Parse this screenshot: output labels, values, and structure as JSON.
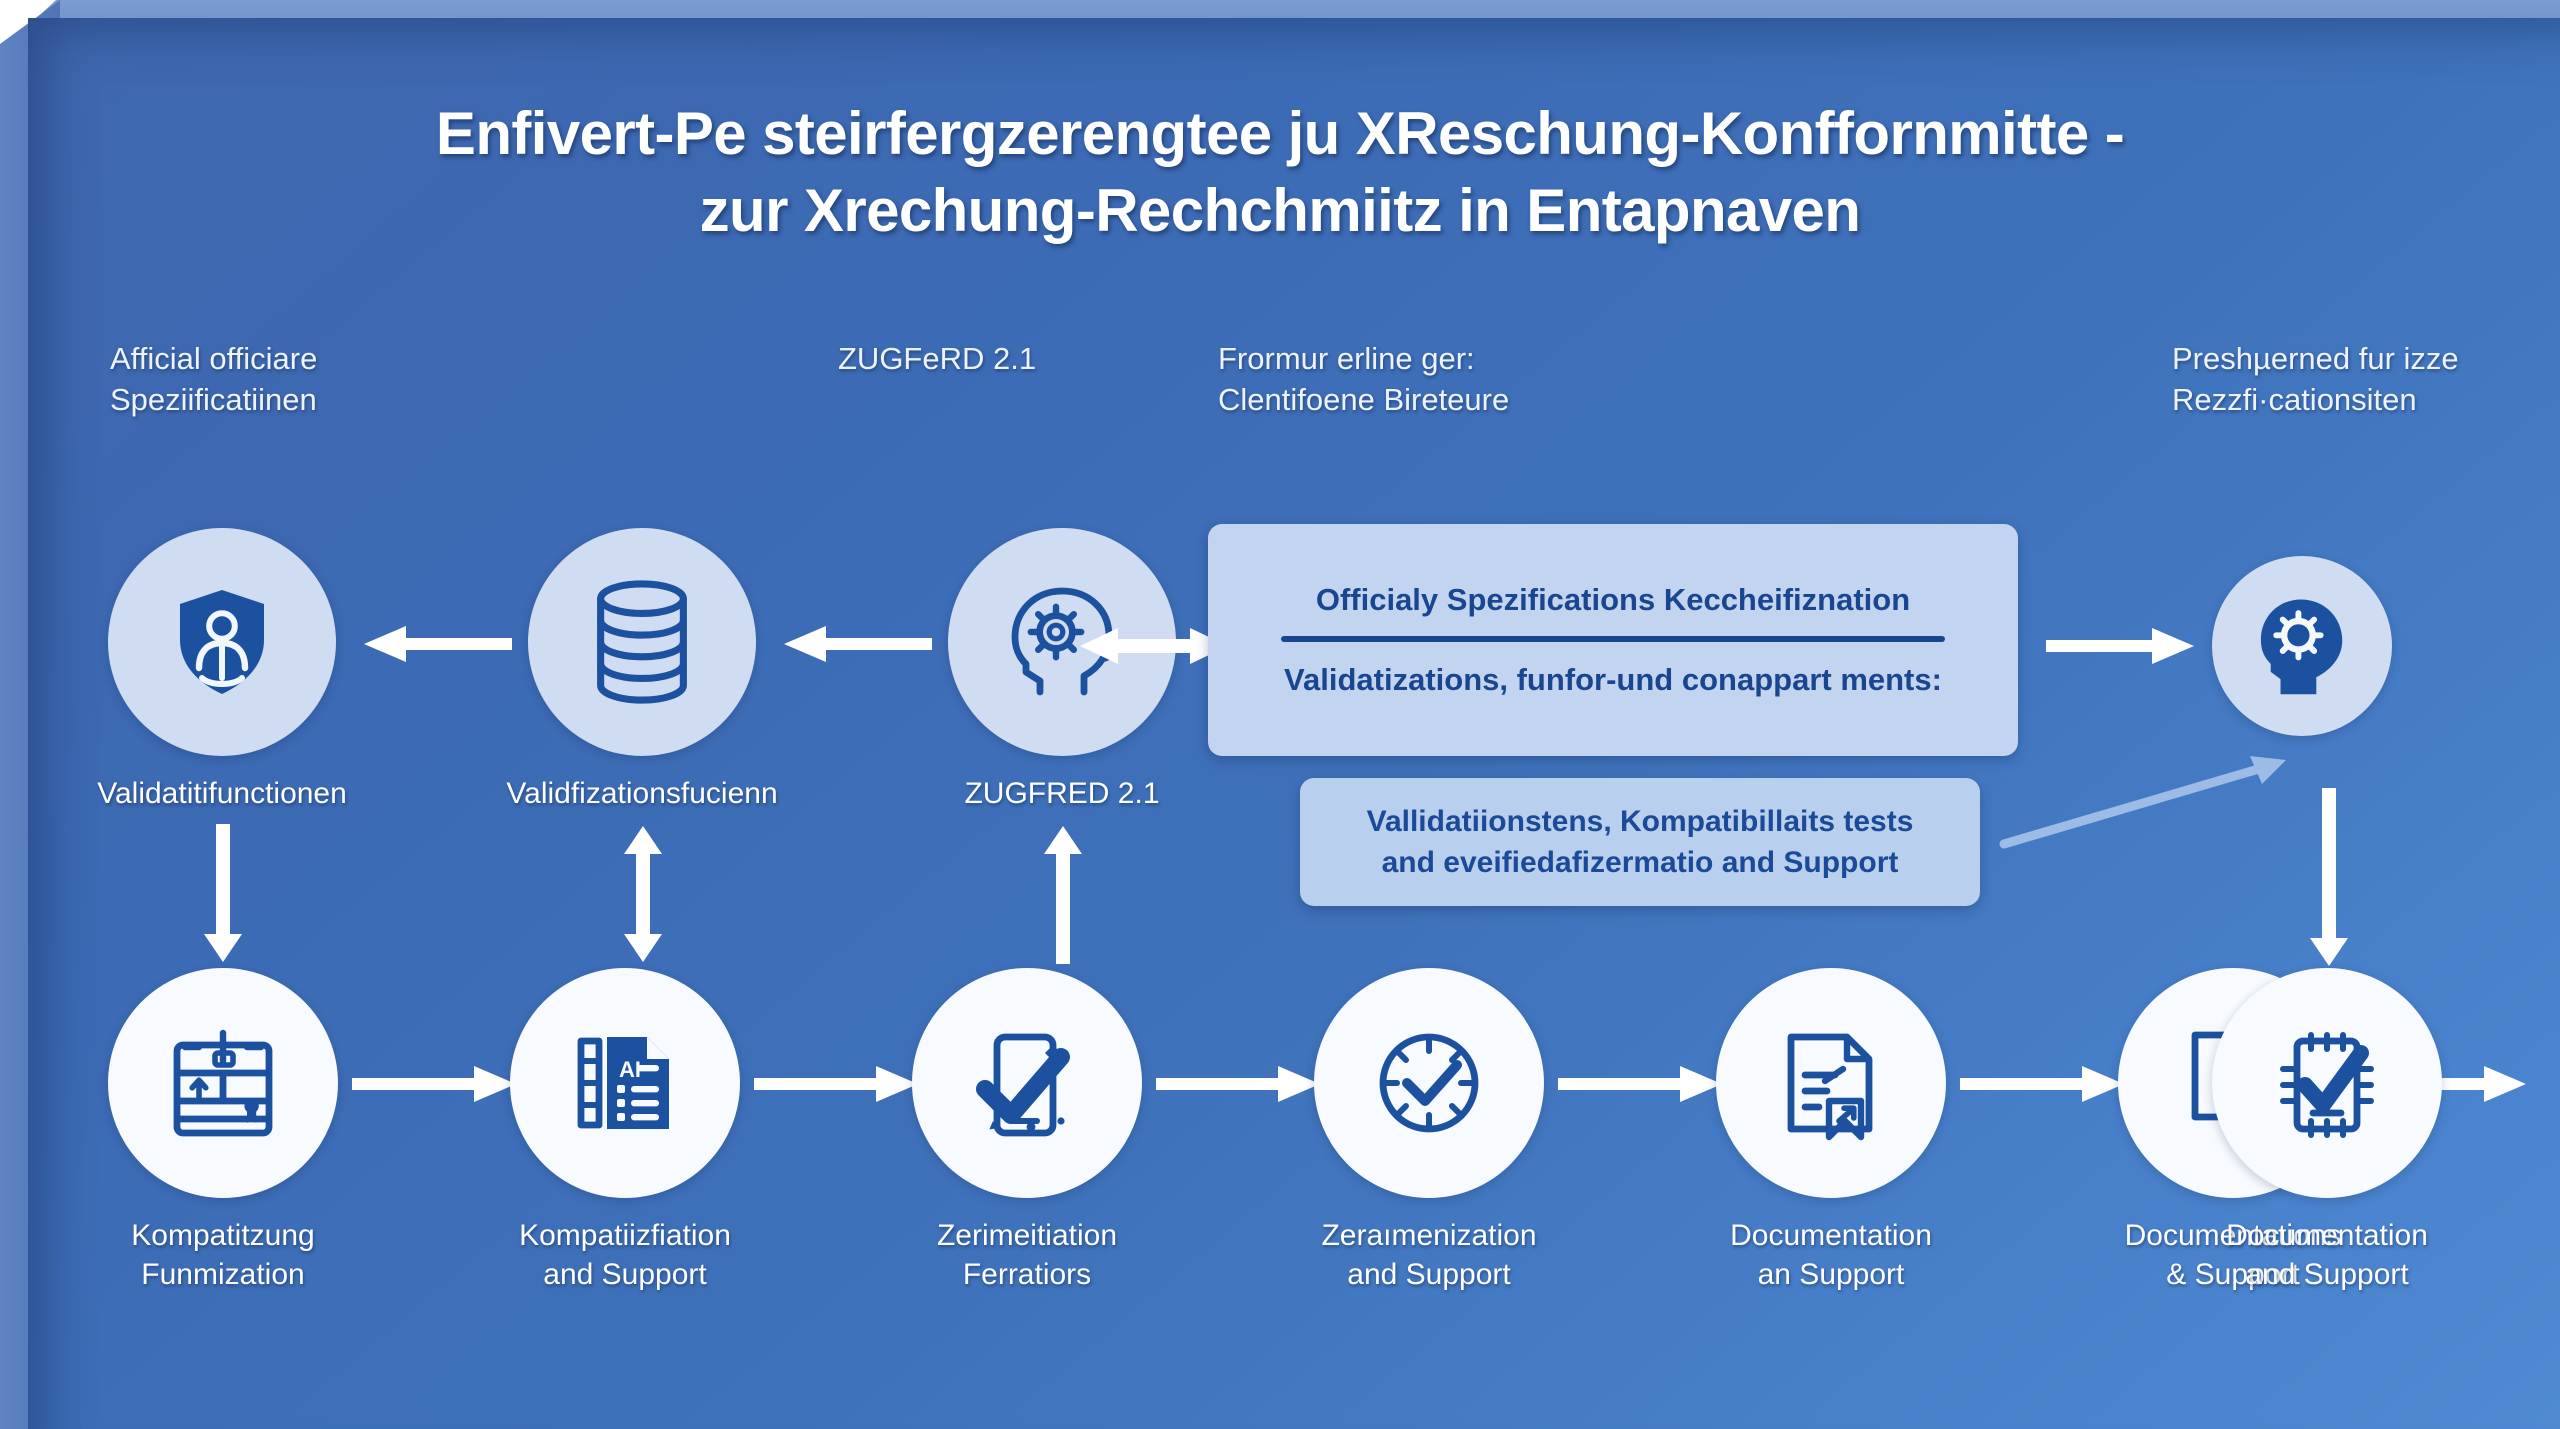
{
  "diagram": {
    "title_line1": "Enfivert-Pe steirfergzerengtee  ju XReschung-Konffornmitte -",
    "title_line2": "zur Xrechung-Rechchmiitz in Entapnaven",
    "captions": [
      {
        "line1": "Afficial officiare",
        "line2": "Speziificatiinen"
      },
      {
        "line1": "ZUGFeRD 2.1",
        "line2": ""
      },
      {
        "line1": "Frormur erline ger:",
        "line2": "Clentifoene Bireteure"
      },
      {
        "line1": "Preshµerned fur izze",
        "line2": "Rezzfi·cationsiten"
      }
    ],
    "top_row": [
      {
        "label": "Validatitifunctionen",
        "icon": "shield-person-icon"
      },
      {
        "label": "Validfizationsfucienn",
        "icon": "database-stack-icon"
      },
      {
        "label": "ZUGFRED 2.1",
        "icon": "head-gear-outline-icon"
      },
      {
        "label": "",
        "icon": "head-gear-filled-icon"
      }
    ],
    "callout_primary": {
      "heading": "Officialy Spezifications Keccheifiznation",
      "subheading": "Validatizations, funfor-und conappart ments:"
    },
    "callout_secondary": {
      "line1": "Vallidatiionstens, Kompatibillaits tests",
      "line2": "and eveifiedafizermatio and Support"
    },
    "bottom_row": [
      {
        "label_line1": "Kompatitzung",
        "label_line2": "Funmization",
        "icon": "certificate-clipboard-icon"
      },
      {
        "label_line1": "Kompatiizfiation",
        "label_line2": "and Support",
        "icon": "ai-document-icon"
      },
      {
        "label_line1": "Zerimeitiation",
        "label_line2": "Ferratiors",
        "icon": "mobile-check-icon"
      },
      {
        "label_line1": "Zeraımenization",
        "label_line2": "and Support",
        "icon": "clock-check-icon"
      },
      {
        "label_line1": "Documentation",
        "label_line2": "an Support",
        "icon": "document-arrow-icon"
      },
      {
        "label_line1": "Documentations",
        "label_line2": "& Support",
        "icon": "document-f-icon"
      },
      {
        "label_line1": "Documentation",
        "label_line2": "and Support",
        "icon": "checklist-check-icon"
      }
    ],
    "colors": {
      "background_blue": "#3f6cb4",
      "panel_light_blue": "#4f8ad3",
      "circle_pale": "#cfdcf2",
      "circle_white": "#f7fafe",
      "icon_blue": "#1c519f",
      "callout_fill": "#c3d4f0",
      "callout_text": "#19468f",
      "arrow_white": "#ffffff",
      "arrow_light": "#9dbbe4"
    }
  }
}
